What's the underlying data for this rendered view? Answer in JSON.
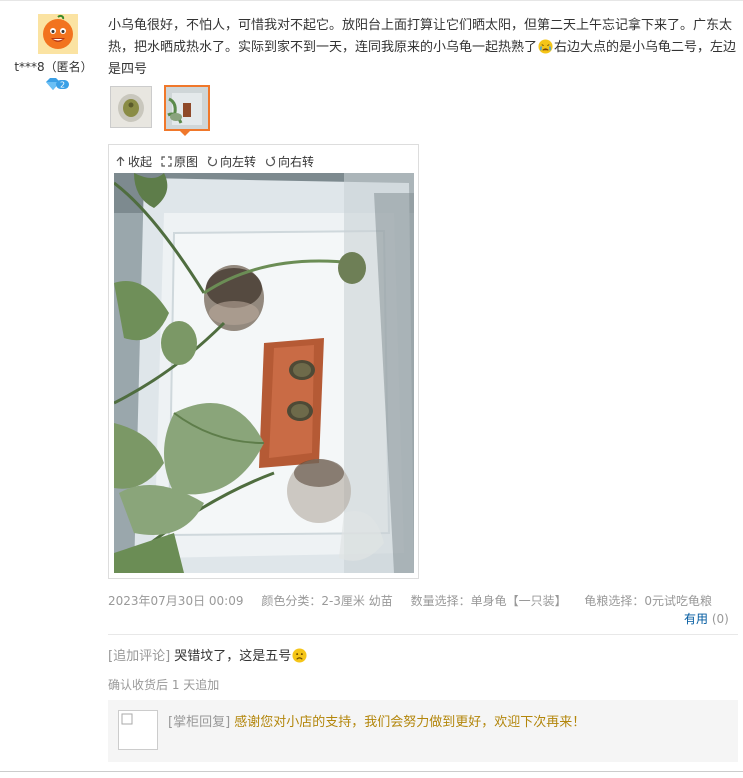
{
  "user": {
    "name": "t***8（匿名）",
    "vip_level": "2"
  },
  "review": {
    "text_part1": "小乌龟很好，不怕人，可惜我对不起它。放阳台上面打算让它们晒太阳，但第二天上午忘记拿下来了。广东太热，把水晒成热水了。实际到家不到一天，连同我原来的小乌龟一起热熟了",
    "emoji1": "crying-face-emoji",
    "text_part2": "右边大点的是小乌龟二号，左边是四号"
  },
  "viewer": {
    "collapse_label": "收起",
    "original_label": "原图",
    "rotate_left_label": "向左转",
    "rotate_right_label": "向右转"
  },
  "meta": {
    "datetime": "2023年07月30日 00:09",
    "color": "颜色分类：2-3厘米 幼苗",
    "quantity": "数量选择：单身龟【一只装】",
    "food": "龟粮选择：0元试吃龟粮"
  },
  "useful": {
    "label": "有用",
    "count": "(0)"
  },
  "append": {
    "tag": "[追加评论]",
    "text": "哭错坟了，这是五号",
    "emoji": "sad-face-emoji",
    "time": "确认收货后 1 天追加"
  },
  "reply": {
    "tag": "[掌柜回复]",
    "text": "感谢您对小店的支持，我们会努力做到更好，欢迎下次再来！"
  },
  "colors": {
    "link_blue": "#005aa0",
    "reply_gold": "#b3860b",
    "thumb_selected": "#f0782b"
  }
}
